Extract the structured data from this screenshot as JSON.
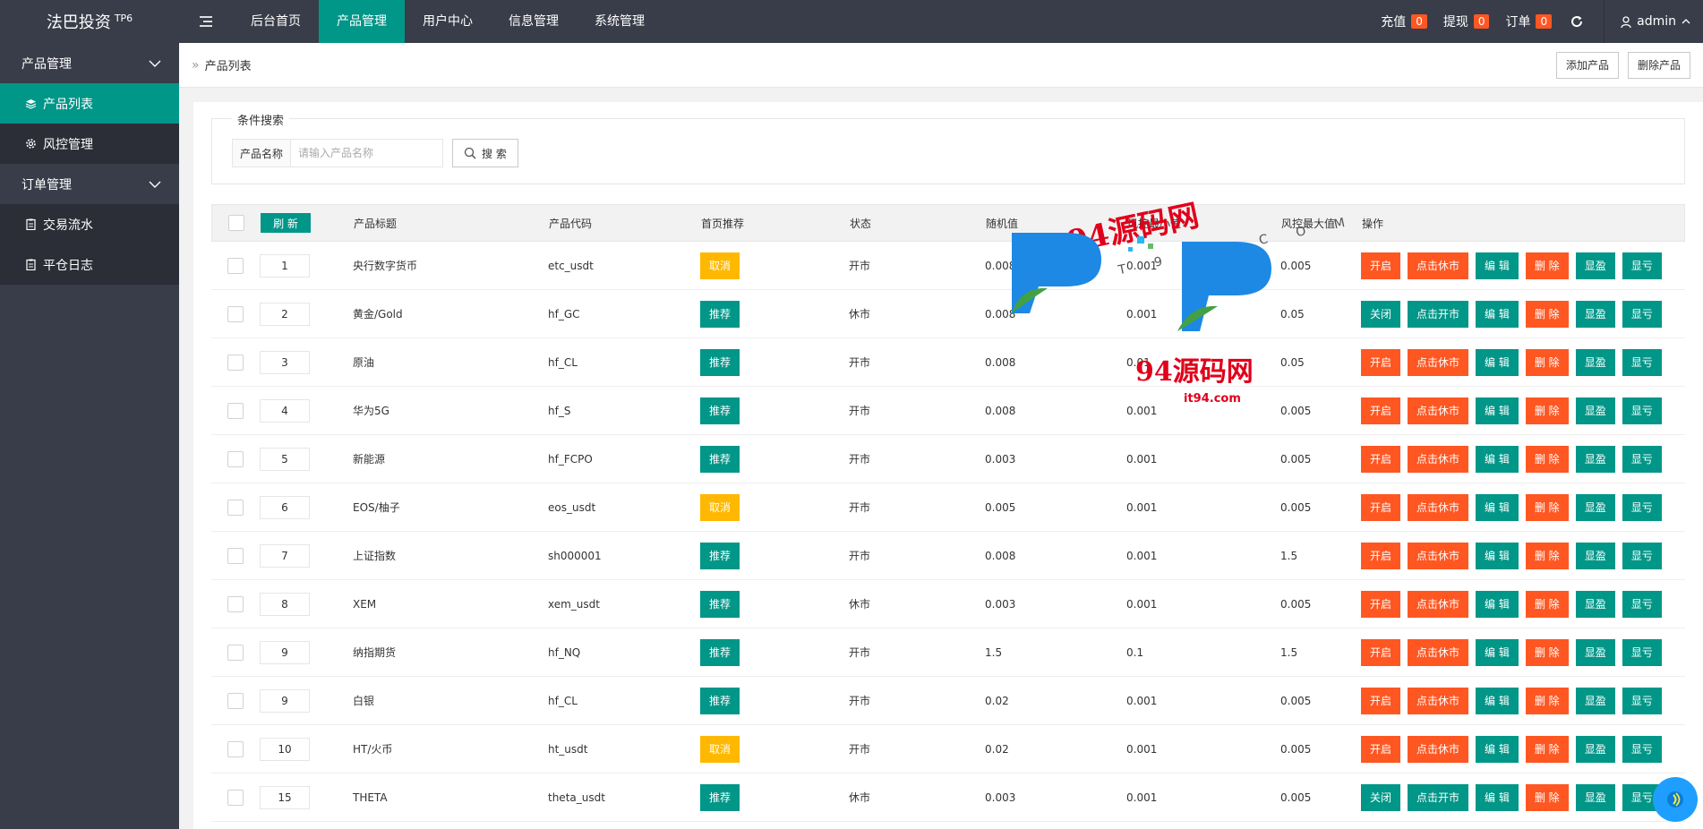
{
  "app": {
    "name": "法巴投资",
    "version_tag": "TP6"
  },
  "topnav": {
    "items": [
      {
        "label": "后台首页",
        "active": false
      },
      {
        "label": "产品管理",
        "active": true
      },
      {
        "label": "用户中心",
        "active": false
      },
      {
        "label": "信息管理",
        "active": false
      },
      {
        "label": "系统管理",
        "active": false
      }
    ]
  },
  "topright": {
    "recharge": {
      "label": "充值",
      "count": "0"
    },
    "withdraw": {
      "label": "提现",
      "count": "0"
    },
    "orders": {
      "label": "订单",
      "count": "0"
    },
    "user": "admin"
  },
  "sidebar": {
    "group1": "产品管理",
    "item_product_list": "产品列表",
    "item_risk": "风控管理",
    "group2": "订单管理",
    "item_trades": "交易流水",
    "item_close_log": "平仓日志"
  },
  "breadcrumb": {
    "current": "产品列表"
  },
  "actions": {
    "add": "添加产品",
    "delete": "删除产品"
  },
  "search": {
    "legend": "条件搜索",
    "field_label": "产品名称",
    "placeholder": "请输入产品名称",
    "button": "搜 索"
  },
  "table": {
    "refresh": "刷 新",
    "headers": {
      "title": "产品标题",
      "code": "产品代码",
      "home": "首页推荐",
      "status": "状态",
      "rand": "随机值",
      "min": "风控最小值",
      "max": "风控最大值",
      "ops": "操作"
    },
    "ops_labels": {
      "edit": "编 辑",
      "del": "删 除",
      "profit": "显盈",
      "loss": "显亏"
    },
    "rows": [
      {
        "sort": "1",
        "title": "央行数字货币",
        "code": "etc_usdt",
        "home": "取消",
        "status": "开市",
        "rand": "0.008",
        "min": "0.001",
        "max": "0.005",
        "toggle": "开启",
        "market": "点击休市"
      },
      {
        "sort": "2",
        "title": "黄金/Gold",
        "code": "hf_GC",
        "home": "推荐",
        "status": "休市",
        "rand": "0.008",
        "min": "0.001",
        "max": "0.05",
        "toggle": "关闭",
        "market": "点击开市"
      },
      {
        "sort": "3",
        "title": "原油",
        "code": "hf_CL",
        "home": "推荐",
        "status": "开市",
        "rand": "0.008",
        "min": "0.01",
        "max": "0.05",
        "toggle": "开启",
        "market": "点击休市"
      },
      {
        "sort": "4",
        "title": "华为5G",
        "code": "hf_S",
        "home": "推荐",
        "status": "开市",
        "rand": "0.008",
        "min": "0.001",
        "max": "0.005",
        "toggle": "开启",
        "market": "点击休市"
      },
      {
        "sort": "5",
        "title": "新能源",
        "code": "hf_FCPO",
        "home": "推荐",
        "status": "开市",
        "rand": "0.003",
        "min": "0.001",
        "max": "0.005",
        "toggle": "开启",
        "market": "点击休市"
      },
      {
        "sort": "6",
        "title": "EOS/柚子",
        "code": "eos_usdt",
        "home": "取消",
        "status": "开市",
        "rand": "0.005",
        "min": "0.001",
        "max": "0.005",
        "toggle": "开启",
        "market": "点击休市"
      },
      {
        "sort": "7",
        "title": "上证指数",
        "code": "sh000001",
        "home": "推荐",
        "status": "开市",
        "rand": "0.008",
        "min": "0.001",
        "max": "1.5",
        "toggle": "开启",
        "market": "点击休市"
      },
      {
        "sort": "8",
        "title": "XEM",
        "code": "xem_usdt",
        "home": "推荐",
        "status": "休市",
        "rand": "0.003",
        "min": "0.001",
        "max": "0.005",
        "toggle": "开启",
        "market": "点击休市"
      },
      {
        "sort": "9",
        "title": "纳指期货",
        "code": "hf_NQ",
        "home": "推荐",
        "status": "开市",
        "rand": "1.5",
        "min": "0.1",
        "max": "1.5",
        "toggle": "开启",
        "market": "点击休市"
      },
      {
        "sort": "9",
        "title": "白银",
        "code": "hf_CL",
        "home": "推荐",
        "status": "开市",
        "rand": "0.02",
        "min": "0.001",
        "max": "0.005",
        "toggle": "开启",
        "market": "点击休市"
      },
      {
        "sort": "10",
        "title": "HT/火币",
        "code": "ht_usdt",
        "home": "取消",
        "status": "开市",
        "rand": "0.02",
        "min": "0.001",
        "max": "0.005",
        "toggle": "开启",
        "market": "点击休市"
      },
      {
        "sort": "15",
        "title": "THETA",
        "code": "theta_usdt",
        "home": "推荐",
        "status": "休市",
        "rand": "0.003",
        "min": "0.001",
        "max": "0.005",
        "toggle": "关闭",
        "market": "点击开市"
      }
    ]
  },
  "watermark": {
    "brand": "94源码网",
    "domain": "it94.com",
    "spaced": "I T 9 4 . C O M"
  },
  "colors": {
    "accent": "#009688",
    "orange": "#ff5722",
    "yellow": "#ffb800",
    "dark": "#393d49"
  }
}
